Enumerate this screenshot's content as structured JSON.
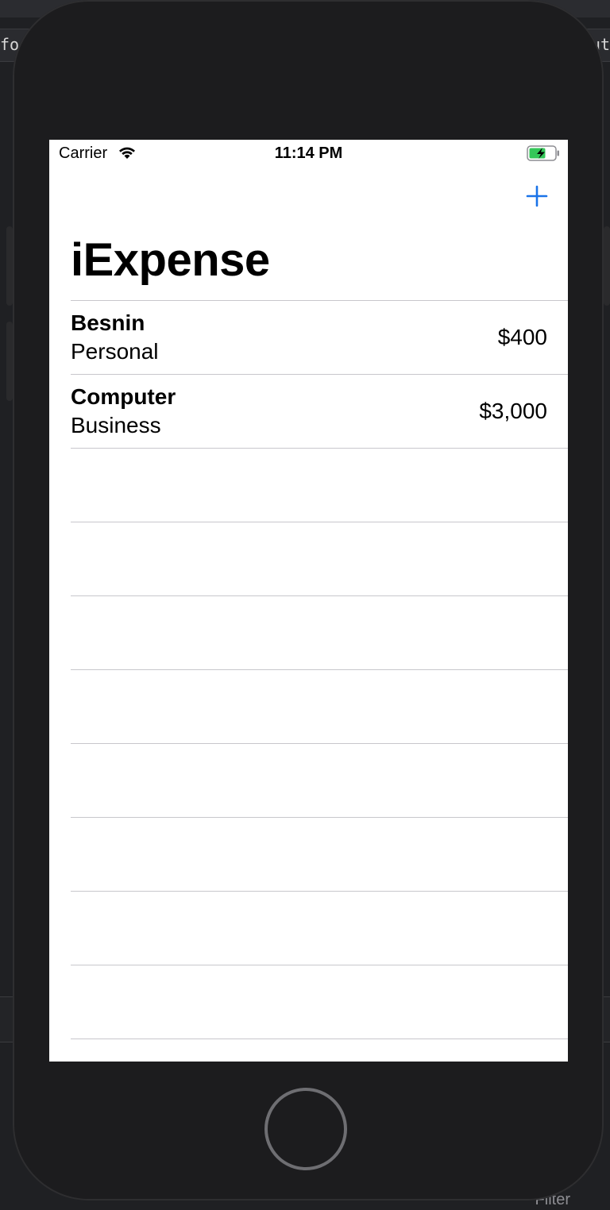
{
  "ide": {
    "tab_left": "for",
    "tab_right": "ut",
    "filter_label": "Filter"
  },
  "status_bar": {
    "carrier": "Carrier",
    "time": "11:14 PM"
  },
  "nav": {
    "title": "iExpense",
    "add_button": "+"
  },
  "expenses": [
    {
      "name": "Besnin",
      "type": "Personal",
      "amount": "$400"
    },
    {
      "name": "Computer",
      "type": "Business",
      "amount": "$3,000"
    }
  ],
  "colors": {
    "accent": "#1a73e8",
    "separator": "#c8c7cc",
    "battery_charge": "#34c759"
  },
  "icons": {
    "wifi": "wifi-icon",
    "battery": "battery-charging-icon",
    "add": "plus-icon"
  }
}
